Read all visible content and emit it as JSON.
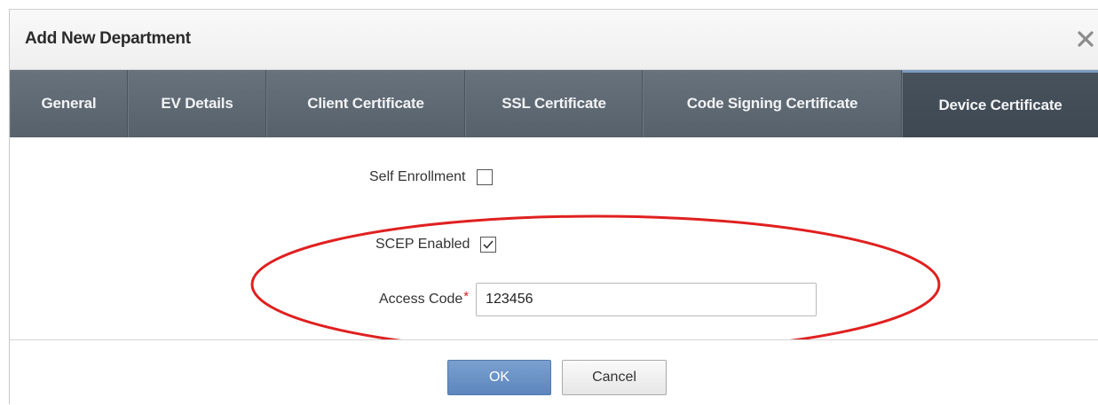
{
  "dialog": {
    "title": "Add New Department",
    "close_symbol": "×"
  },
  "tabs": [
    {
      "label": "General",
      "active": false
    },
    {
      "label": "EV Details",
      "active": false
    },
    {
      "label": "Client Certificate",
      "active": false
    },
    {
      "label": "SSL Certificate",
      "active": false
    },
    {
      "label": "Code Signing Certificate",
      "active": false
    },
    {
      "label": "Device Certificate",
      "active": true
    }
  ],
  "form": {
    "self_enrollment": {
      "label": "Self Enrollment",
      "checked": false
    },
    "scep_enabled": {
      "label": "SCEP Enabled",
      "checked": true
    },
    "access_code": {
      "label": "Access Code",
      "required_mark": "*",
      "value": "123456"
    }
  },
  "buttons": {
    "ok": "OK",
    "cancel": "Cancel"
  },
  "colors": {
    "tab_bar": "#5c6670",
    "active_tab": "#434d57",
    "ok_button": "#6a92c6",
    "highlight": "#e02020",
    "required": "#d22020"
  },
  "icons": {
    "close": "close-icon",
    "checkmark": "checkmark-icon"
  }
}
